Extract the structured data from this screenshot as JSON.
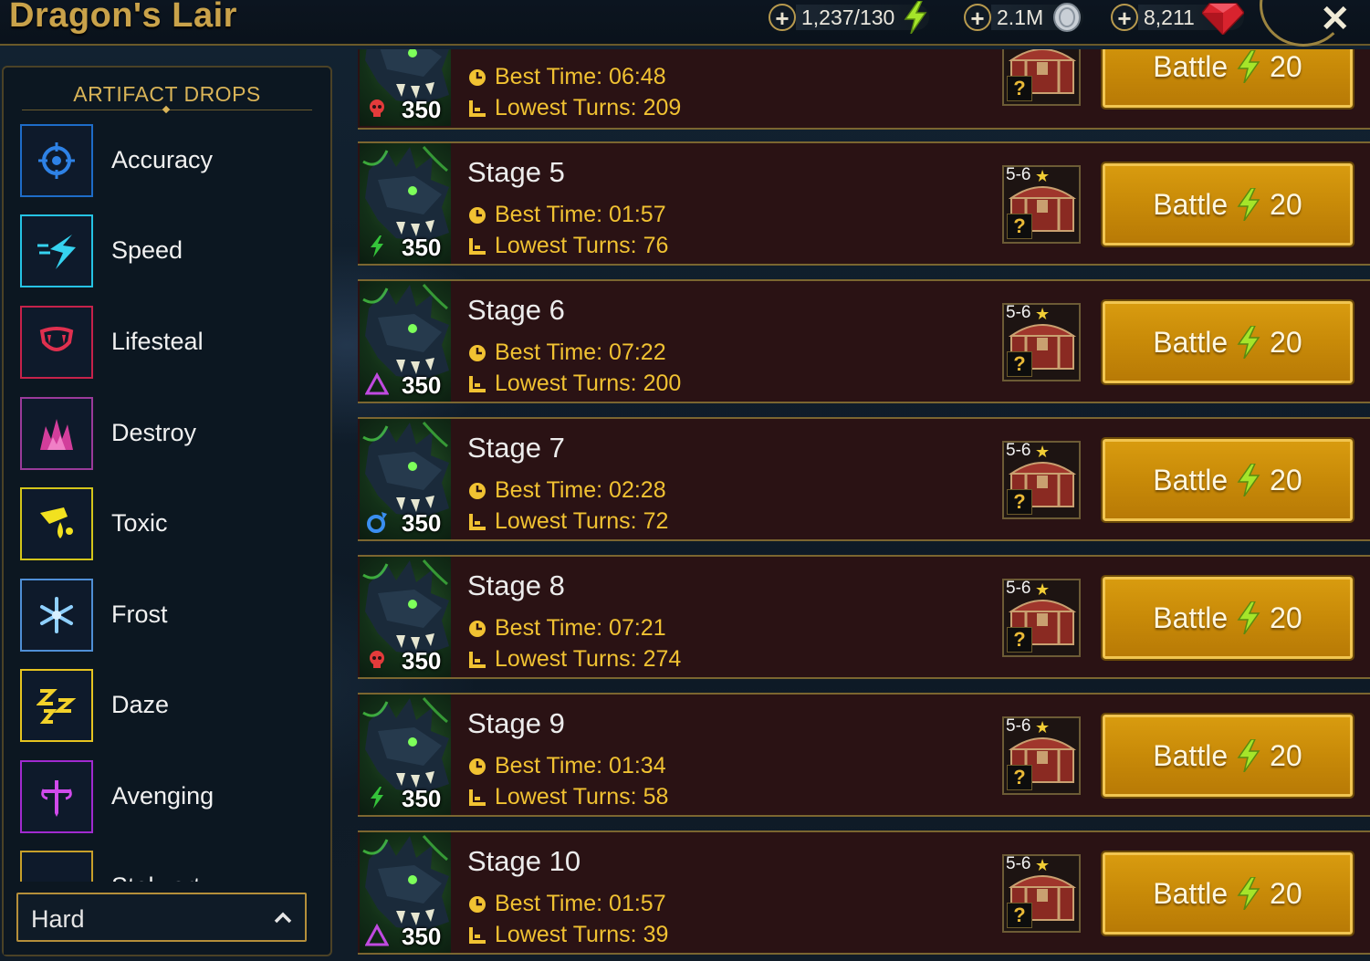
{
  "header": {
    "title": "Dragon's Lair",
    "energy": "1,237/130",
    "silver": "2.1M",
    "gems": "8,211"
  },
  "sidebar": {
    "title": "ARTIFACT DROPS",
    "items": [
      {
        "label": "Accuracy",
        "icon": "crosshair-icon",
        "color": "#1e6cc8"
      },
      {
        "label": "Speed",
        "icon": "speed-icon",
        "color": "#25c3e4"
      },
      {
        "label": "Lifesteal",
        "icon": "fangs-icon",
        "color": "#c6224a"
      },
      {
        "label": "Destroy",
        "icon": "destroy-icon",
        "color": "#9a3a9a"
      },
      {
        "label": "Toxic",
        "icon": "toxic-icon",
        "color": "#d4c51a"
      },
      {
        "label": "Frost",
        "icon": "snowflake-icon",
        "color": "#4f8fd6"
      },
      {
        "label": "Daze",
        "icon": "zzz-icon",
        "color": "#e6c420"
      },
      {
        "label": "Avenging",
        "icon": "sword-icon",
        "color": "#a12ad0"
      },
      {
        "label": "Stalwart",
        "icon": "shield-icon",
        "color": "#c8a02a"
      }
    ],
    "difficulty": "Hard"
  },
  "stages": [
    {
      "name": "",
      "best_time": "Best Time: 06:48",
      "lowest_turns": "Lowest Turns: 209",
      "power": "350",
      "affinity": "force",
      "rank": "",
      "battle": "Battle",
      "cost": "20"
    },
    {
      "name": "Stage 5",
      "best_time": "Best Time: 01:57",
      "lowest_turns": "Lowest Turns: 76",
      "power": "350",
      "affinity": "spirit",
      "rank": "5-6",
      "battle": "Battle",
      "cost": "20"
    },
    {
      "name": "Stage 6",
      "best_time": "Best Time: 07:22",
      "lowest_turns": "Lowest Turns: 200",
      "power": "350",
      "affinity": "void",
      "rank": "5-6",
      "battle": "Battle",
      "cost": "20"
    },
    {
      "name": "Stage 7",
      "best_time": "Best Time: 02:28",
      "lowest_turns": "Lowest Turns: 72",
      "power": "350",
      "affinity": "magic",
      "rank": "5-6",
      "battle": "Battle",
      "cost": "20"
    },
    {
      "name": "Stage 8",
      "best_time": "Best Time: 07:21",
      "lowest_turns": "Lowest Turns: 274",
      "power": "350",
      "affinity": "force",
      "rank": "5-6",
      "battle": "Battle",
      "cost": "20"
    },
    {
      "name": "Stage 9",
      "best_time": "Best Time: 01:34",
      "lowest_turns": "Lowest Turns: 58",
      "power": "350",
      "affinity": "spirit",
      "rank": "5-6",
      "battle": "Battle",
      "cost": "20"
    },
    {
      "name": "Stage 10",
      "best_time": "Best Time: 01:57",
      "lowest_turns": "Lowest Turns: 39",
      "power": "350",
      "affinity": "void",
      "rank": "5-6",
      "battle": "Battle",
      "cost": "20"
    }
  ]
}
